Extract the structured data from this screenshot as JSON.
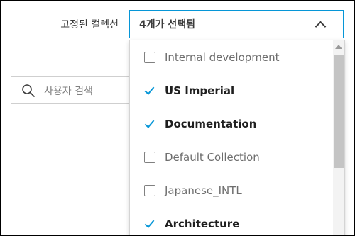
{
  "filter": {
    "pinned_label": "고정된 컬렉션",
    "selected_summary": "4개가 선택됨"
  },
  "search": {
    "placeholder": "사용자 검색"
  },
  "dropdown": {
    "items": [
      {
        "label": "Internal development",
        "checked": false
      },
      {
        "label": "US Imperial",
        "checked": true
      },
      {
        "label": "Documentation",
        "checked": true
      },
      {
        "label": "Default Collection",
        "checked": false
      },
      {
        "label": "Japanese_INTL",
        "checked": false
      },
      {
        "label": "Architecture",
        "checked": true
      }
    ]
  },
  "colors": {
    "accent": "#0696d7",
    "text": "#3c3c3c",
    "muted_text": "#6e6e6e"
  }
}
